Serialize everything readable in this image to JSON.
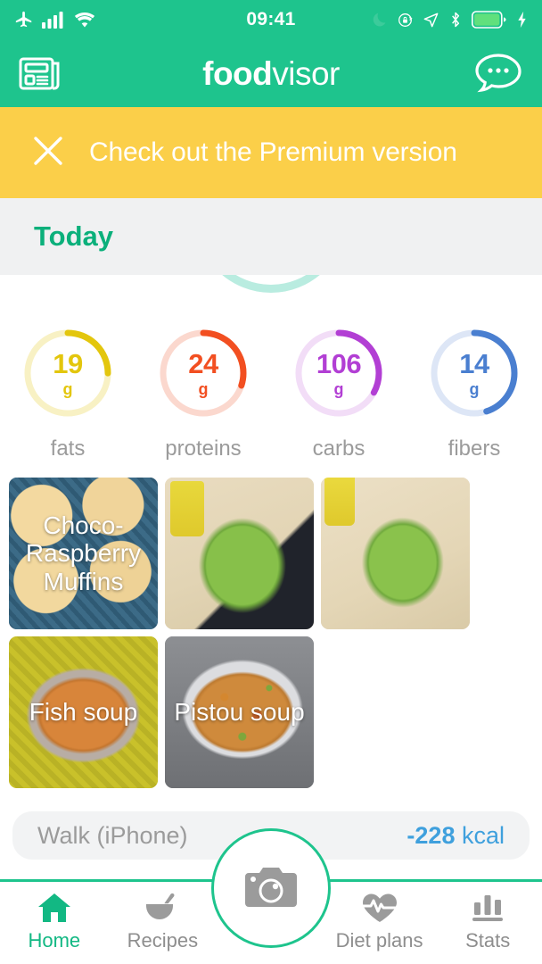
{
  "status_bar": {
    "time": "09:41",
    "icons_left": [
      "airplane-mode-icon",
      "cellular-signal-icon",
      "wifi-icon"
    ],
    "icons_right": [
      "do-not-disturb-moon-icon",
      "rotation-lock-icon",
      "location-arrow-icon",
      "bluetooth-icon",
      "battery-icon",
      "charging-bolt-icon"
    ]
  },
  "header": {
    "brand_bold": "food",
    "brand_light": "visor",
    "left_icon": "news-feed-icon",
    "right_icon": "chat-bubble-icon",
    "background": "#1ec48d"
  },
  "banner": {
    "close_icon": "close-x-icon",
    "text": "Check out the Premium version",
    "background": "#fbcf49"
  },
  "section": {
    "today_label": "Today",
    "background": "#f0f1f2",
    "accent": "#0bb07b"
  },
  "macros": [
    {
      "name": "fats",
      "value": "19",
      "unit": "g",
      "label": "fats",
      "color": "#e3c60d",
      "track": "#f8f1c4",
      "percent": 25
    },
    {
      "name": "proteins",
      "value": "24",
      "unit": "g",
      "label": "proteins",
      "color": "#f24f21",
      "track": "#fbd8ce",
      "percent": 30
    },
    {
      "name": "carbs",
      "value": "106",
      "unit": "g",
      "label": "carbs",
      "color": "#b23fd4",
      "track": "#f2ddf7",
      "percent": 33
    },
    {
      "name": "fibers",
      "value": "14",
      "unit": "g",
      "label": "fibers",
      "color": "#4a7fd0",
      "track": "#dde6f6",
      "percent": 45
    }
  ],
  "food_rows": [
    [
      {
        "title": "Choco-Raspberry Muffins",
        "photo": "choco-raspberry-muffins-photo"
      },
      {
        "title": "",
        "photo": "green-apple-on-desk-photo"
      },
      {
        "title": "",
        "photo": "green-apple-closeup-photo"
      }
    ],
    [
      {
        "title": "Fish soup",
        "photo": "fish-soup-bowl-photo"
      },
      {
        "title": "Pistou soup",
        "photo": "pistou-soup-bowl-photo"
      }
    ]
  ],
  "activity": {
    "name": "Walk (iPhone)",
    "kcal_value": "-228",
    "kcal_unit": "kcal",
    "kcal_color": "#3fa0dd"
  },
  "tabs": [
    {
      "label": "Home",
      "icon": "home-icon",
      "active": true
    },
    {
      "label": "Recipes",
      "icon": "mortar-pestle-icon",
      "active": false
    },
    {
      "label": "Diet plans",
      "icon": "heart-pulse-icon",
      "active": false
    },
    {
      "label": "Stats",
      "icon": "bar-chart-icon",
      "active": false
    }
  ],
  "camera_button": {
    "icon": "camera-icon",
    "ring_color": "#1ec48d"
  }
}
